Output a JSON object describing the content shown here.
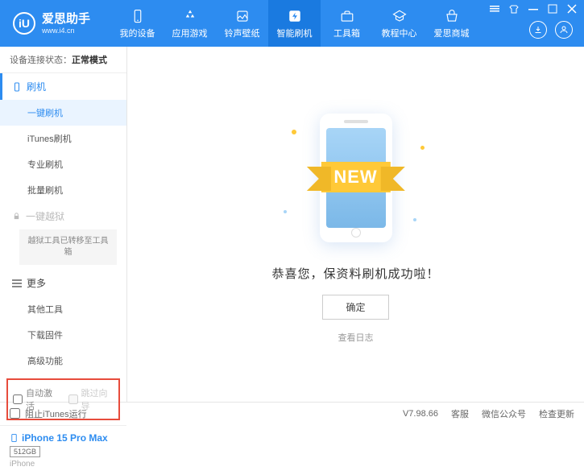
{
  "logo": {
    "icon_text": "iU",
    "title": "爱思助手",
    "url": "www.i4.cn"
  },
  "nav": [
    {
      "label": "我的设备"
    },
    {
      "label": "应用游戏"
    },
    {
      "label": "铃声壁纸"
    },
    {
      "label": "智能刷机"
    },
    {
      "label": "工具箱"
    },
    {
      "label": "教程中心"
    },
    {
      "label": "爱思商城"
    }
  ],
  "status": {
    "label": "设备连接状态：",
    "value": "正常模式"
  },
  "sidebar": {
    "flash": {
      "header": "刷机",
      "items": [
        "一键刷机",
        "iTunes刷机",
        "专业刷机",
        "批量刷机"
      ]
    },
    "jailbreak": {
      "header": "一键越狱",
      "note": "越狱工具已转移至工具箱"
    },
    "more": {
      "header": "更多",
      "items": [
        "其他工具",
        "下载固件",
        "高级功能"
      ]
    }
  },
  "checkboxes": {
    "auto_activate": "自动激活",
    "skip_setup": "跳过向导"
  },
  "device": {
    "name": "iPhone 15 Pro Max",
    "storage": "512GB",
    "type": "iPhone"
  },
  "main": {
    "ribbon": "NEW",
    "message": "恭喜您，保资料刷机成功啦！",
    "ok": "确定",
    "log": "查看日志"
  },
  "footer": {
    "block_itunes": "阻止iTunes运行",
    "version": "V7.98.66",
    "links": [
      "客服",
      "微信公众号",
      "检查更新"
    ]
  }
}
